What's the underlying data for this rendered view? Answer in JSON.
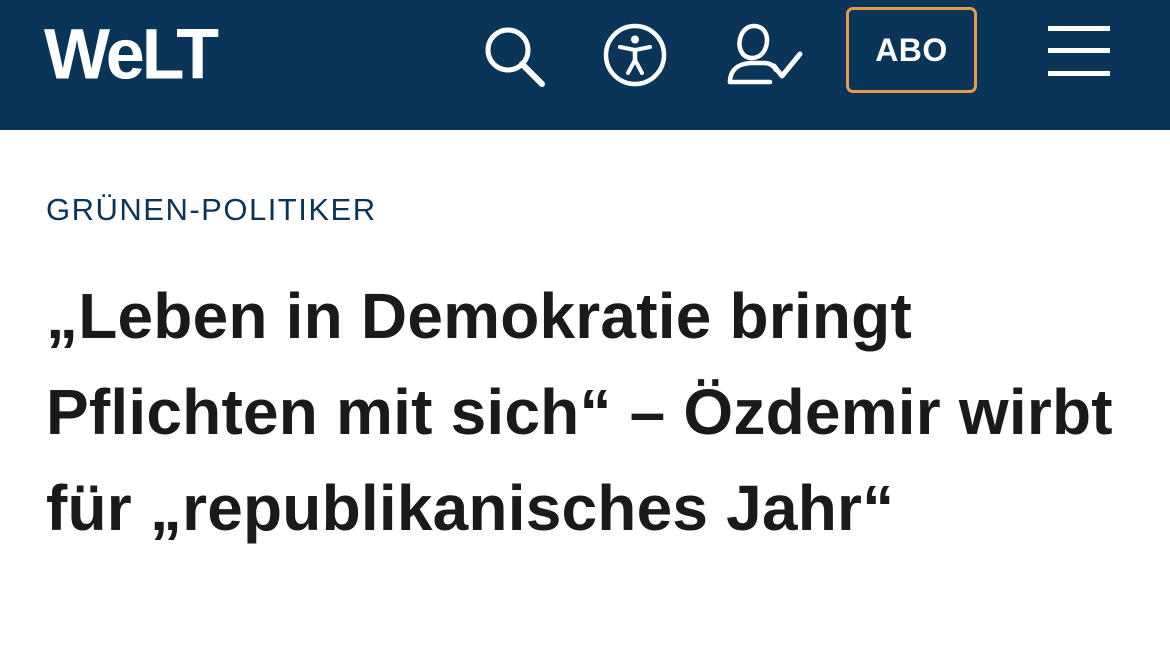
{
  "colors": {
    "brand": "#0b3558",
    "accent": "#e59b45",
    "text": "#1a1a1a"
  },
  "header": {
    "logo": "WeLT",
    "icons": [
      "search-icon",
      "accessibility-icon",
      "user-login-icon",
      "menu-icon"
    ],
    "abo_label": "ABO"
  },
  "article": {
    "kicker": "GRÜNEN-POLITIKER",
    "headline": "„Leben in Demokratie bringt Pflichten mit sich“ – Özdemir wirbt für „republikanisches Jahr“"
  }
}
